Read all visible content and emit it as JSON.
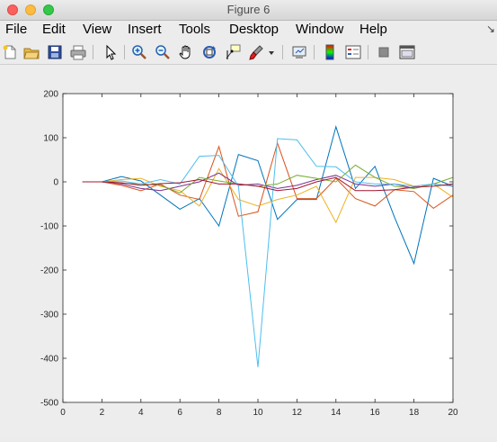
{
  "window": {
    "title": "Figure 6"
  },
  "menu": {
    "items": [
      "File",
      "Edit",
      "View",
      "Insert",
      "Tools",
      "Desktop",
      "Window",
      "Help"
    ]
  },
  "toolbar": {
    "buttons": [
      "new-figure-icon",
      "open-file-icon",
      "save-icon",
      "print-icon",
      "select-arrow-icon",
      "zoom-in-icon",
      "zoom-out-icon",
      "pan-hand-icon",
      "rotate-3d-icon",
      "data-cursor-icon",
      "brush-icon",
      "brush-dropdown-icon",
      "link-plot-icon",
      "insert-colorbar-icon",
      "insert-legend-icon",
      "hide-plot-tools-icon",
      "show-plot-tools-icon"
    ]
  },
  "chart_data": {
    "type": "line",
    "title": "",
    "xlabel": "",
    "ylabel": "",
    "xlim": [
      0,
      20
    ],
    "ylim": [
      -500,
      200
    ],
    "xticks": [
      "0",
      "2",
      "4",
      "6",
      "8",
      "10",
      "12",
      "14",
      "16",
      "18",
      "20"
    ],
    "yticks": [
      "-500",
      "-400",
      "-300",
      "-200",
      "-100",
      "0",
      "100",
      "200"
    ],
    "grid": false,
    "x": [
      1,
      2,
      3,
      4,
      5,
      6,
      7,
      8,
      9,
      10,
      11,
      12,
      13,
      14,
      15,
      16,
      17,
      18,
      19,
      20
    ],
    "series": [
      {
        "color": "#0072bd",
        "values": [
          0,
          0,
          12,
          2,
          -30,
          -62,
          -38,
          -100,
          62,
          48,
          -85,
          -40,
          -40,
          125,
          -15,
          35,
          -80,
          -185,
          8,
          -10
        ]
      },
      {
        "color": "#d95319",
        "values": [
          0,
          0,
          -8,
          -20,
          -5,
          -30,
          -40,
          80,
          -78,
          -68,
          88,
          -38,
          -38,
          8,
          -38,
          -55,
          -18,
          -22,
          -60,
          -30
        ]
      },
      {
        "color": "#edb120",
        "values": [
          0,
          0,
          5,
          8,
          -10,
          -20,
          -55,
          30,
          -40,
          -55,
          -40,
          -30,
          -10,
          -92,
          10,
          10,
          5,
          -10,
          -5,
          -35
        ]
      },
      {
        "color": "#7e2f8e",
        "values": [
          0,
          0,
          -5,
          -15,
          -20,
          -10,
          0,
          20,
          -8,
          -5,
          -15,
          -8,
          5,
          15,
          -5,
          -10,
          -5,
          -15,
          -5,
          -10
        ]
      },
      {
        "color": "#77ac30",
        "values": [
          0,
          0,
          -3,
          -5,
          -8,
          -25,
          10,
          2,
          -5,
          -10,
          -5,
          15,
          8,
          0,
          38,
          10,
          -10,
          -15,
          -5,
          10
        ]
      },
      {
        "color": "#4dbeee",
        "values": [
          0,
          0,
          2,
          -5,
          5,
          -5,
          58,
          60,
          -10,
          -420,
          98,
          95,
          35,
          34,
          0,
          -5,
          -5,
          -10,
          -5,
          -10
        ]
      },
      {
        "color": "#a2142f",
        "values": [
          0,
          0,
          -2,
          -8,
          -4,
          -2,
          5,
          -5,
          -5,
          -10,
          -20,
          -15,
          0,
          10,
          -20,
          -20,
          -18,
          -12,
          -10,
          -5
        ]
      }
    ]
  }
}
